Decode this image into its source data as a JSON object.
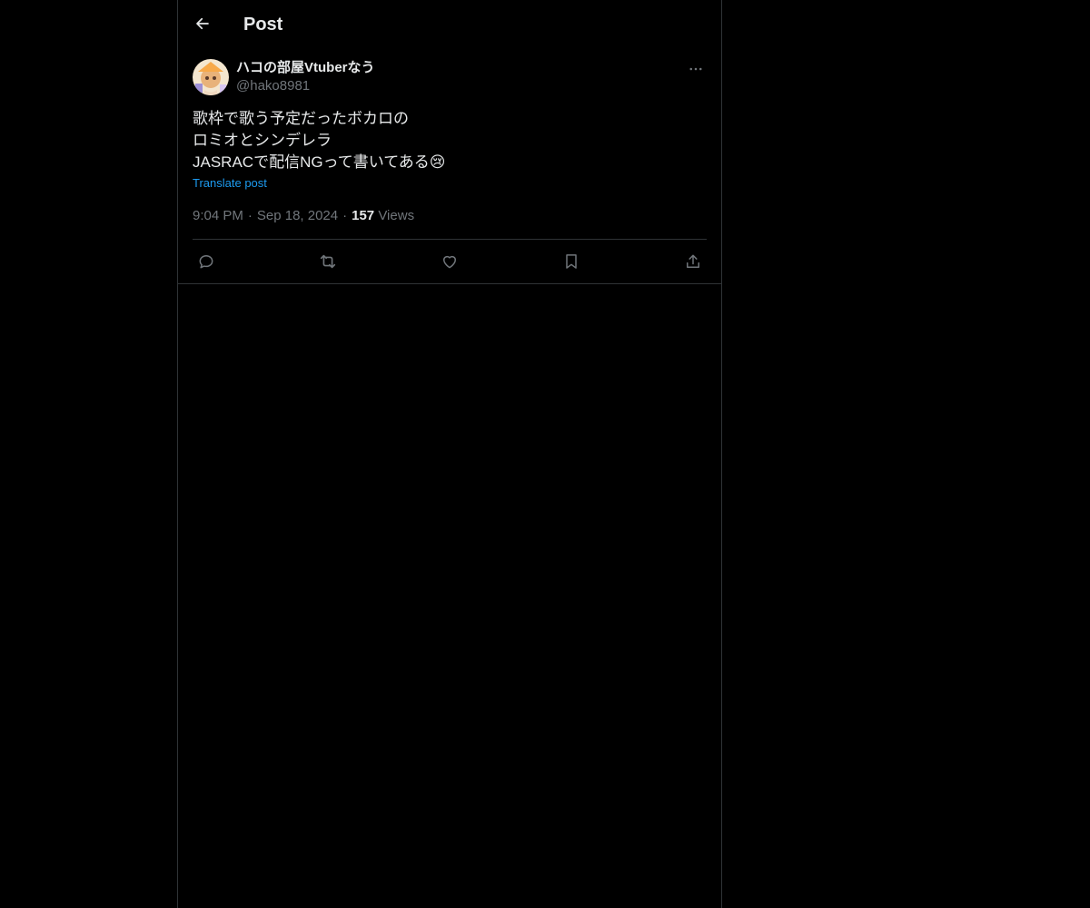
{
  "header": {
    "title": "Post",
    "back_icon": "arrow-left-icon"
  },
  "post": {
    "author": {
      "display_name": "ハコの部屋Vtuberなう",
      "handle": "@hako8981"
    },
    "text_lines": [
      "歌枠で歌う予定だったボカロの",
      "ロミオとシンデレラ",
      "JASRACで配信NGって書いてある😢"
    ],
    "translate_label": "Translate post",
    "time": "9:04 PM",
    "date": "Sep 18, 2024",
    "views_count": "157",
    "views_label": "Views",
    "separator": "·"
  },
  "actions": {
    "reply_icon": "reply-icon",
    "repost_icon": "repost-icon",
    "like_icon": "heart-icon",
    "bookmark_icon": "bookmark-icon",
    "share_icon": "share-icon"
  },
  "colors": {
    "background": "#000000",
    "text": "#e7e9ea",
    "muted": "#71767b",
    "link": "#1d9bf0",
    "border": "#2f3336"
  }
}
